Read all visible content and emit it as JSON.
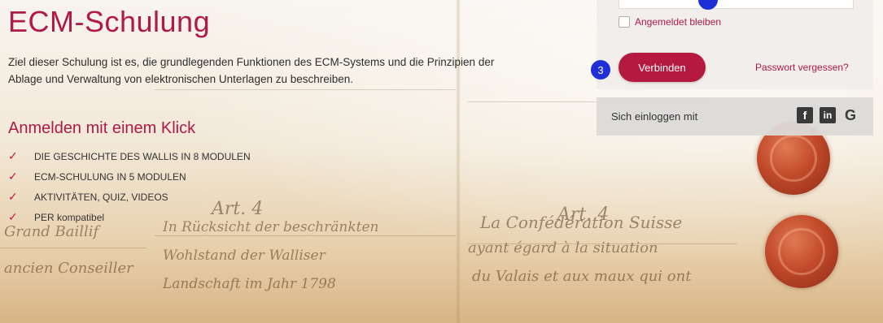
{
  "page": {
    "title": "ECM-Schulung",
    "intro": "Ziel dieser Schulung ist es, die grundlegenden Funktionen des ECM-Systems und die Prinzipien der Ablage und Verwaltung von elektronischen Unterlagen zu beschreiben.",
    "subtitle": "Anmelden mit einem Klick",
    "features": [
      "DIE GESCHICHTE DES WALLIS IN 8 MODULEN",
      "ECM-SCHULUNG IN 5 MODULEN",
      "AKTIVITÄTEN, QUIZ, VIDEOS",
      "PER kompatibel"
    ]
  },
  "login": {
    "remember_label": "Angemeldet bleiben",
    "connect_label": "Verbinden",
    "forgot_label": "Passwort vergessen?",
    "step_marker": "3",
    "social_label": "Sich einloggen mit",
    "social_icons": [
      "facebook-icon",
      "linkedin-icon",
      "google-icon"
    ],
    "social_glyphs": {
      "facebook": "f",
      "linkedin": "in",
      "google": "G"
    }
  },
  "colors": {
    "accent": "#b01a48",
    "button": "#b5193f",
    "marker": "#1f2fd6"
  }
}
